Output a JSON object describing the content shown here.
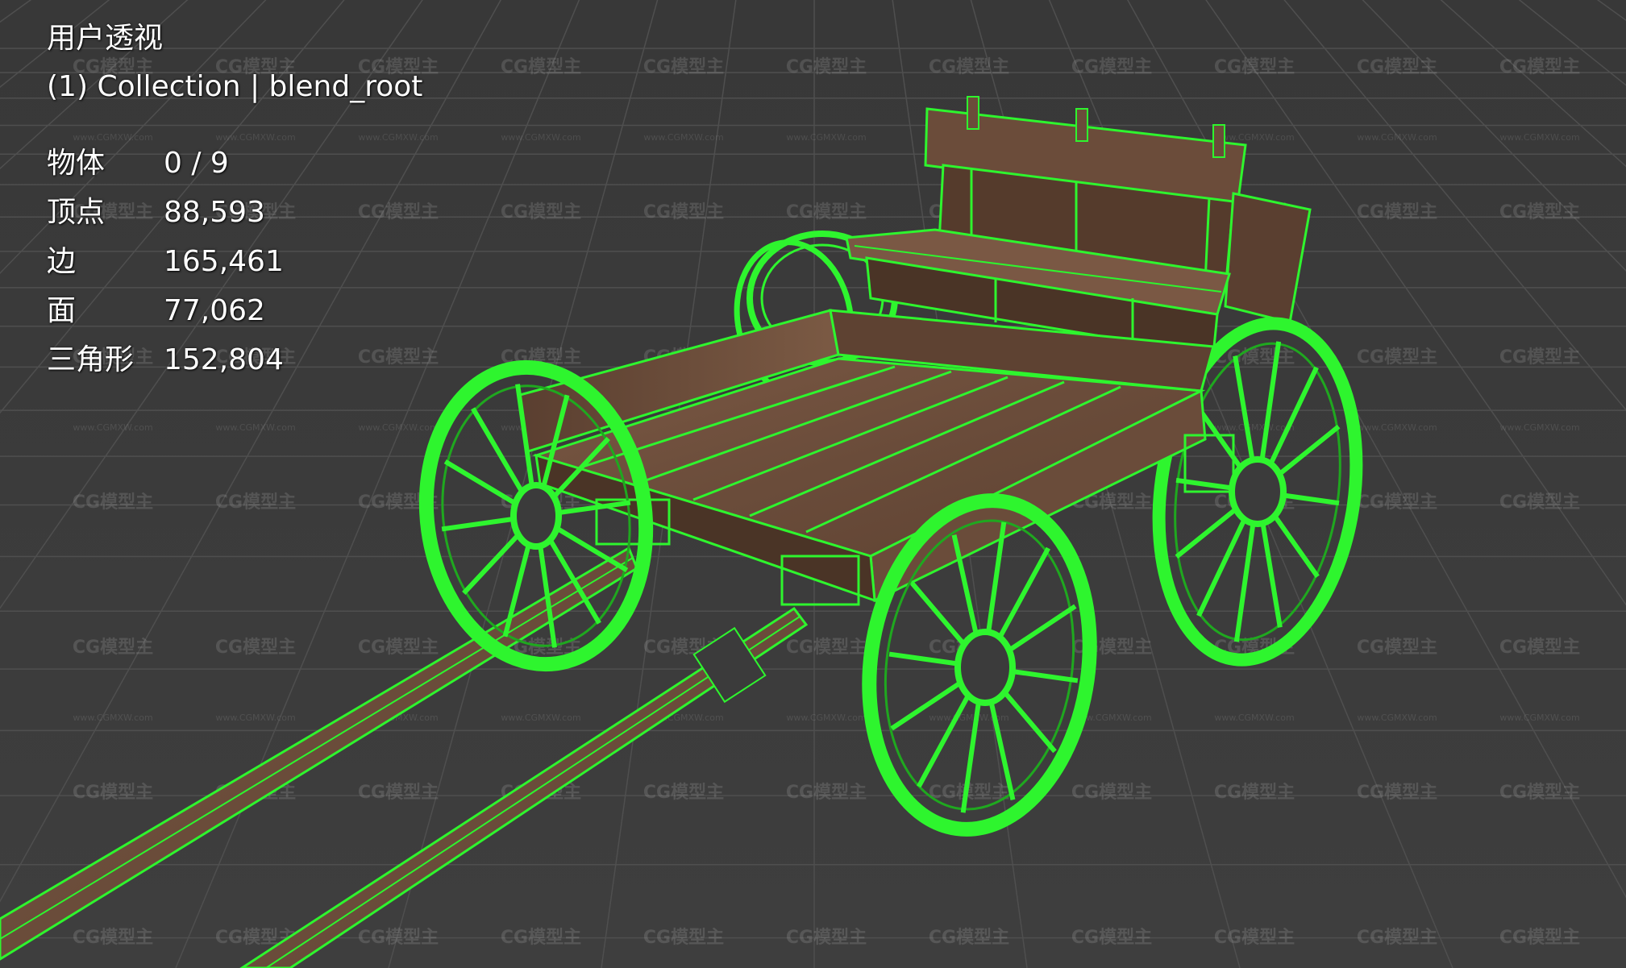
{
  "viewport": {
    "view_name": "用户透视",
    "collection_label": "(1) Collection | blend_root",
    "stats": [
      {
        "label": "物体",
        "value": "0 / 9"
      },
      {
        "label": "顶点",
        "value": "88,593"
      },
      {
        "label": "边",
        "value": "165,461"
      },
      {
        "label": "面",
        "value": "77,062"
      },
      {
        "label": "三角形",
        "value": "152,804"
      }
    ]
  },
  "watermark": {
    "brand": "CG模型主",
    "url": "www.CGMXW.com"
  },
  "colors": {
    "background": "#3b3b3b",
    "grid": "#4e4e4e",
    "wireframe_selected": "#2ef52e",
    "wood": "#6e4e3a",
    "wood_dark": "#4a3426"
  }
}
